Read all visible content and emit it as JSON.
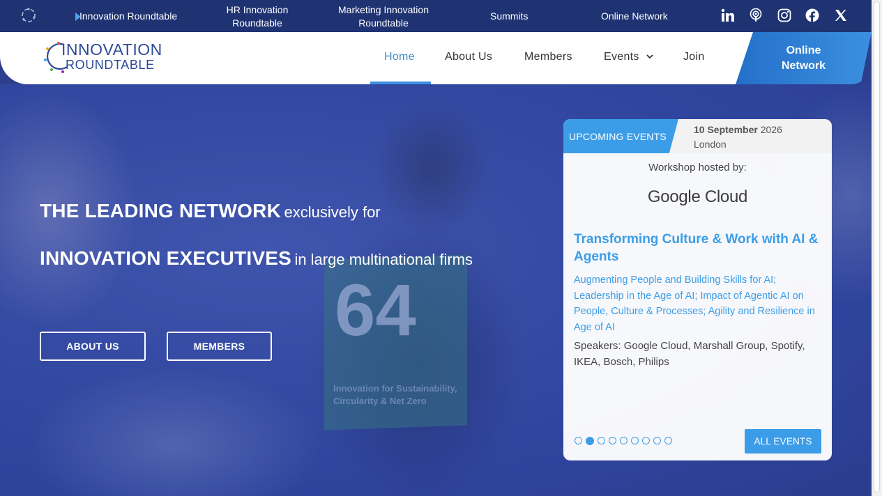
{
  "topbar": {
    "links": [
      "Innovation Roundtable",
      "HR Innovation Roundtable",
      "Marketing Innovation Roundtable",
      "Summits",
      "Online Network"
    ],
    "hr_line1": "HR Innovation",
    "hr_line2": "Roundtable",
    "mkt_line1": "Marketing Innovation",
    "mkt_line2": "Roundtable",
    "social_icons": [
      "linkedin-icon",
      "podcast-icon",
      "instagram-icon",
      "facebook-icon",
      "x-icon"
    ]
  },
  "header": {
    "logo_line1": "INNOVATION",
    "logo_line2": "ROUNDTABLE",
    "nav": [
      "Home",
      "About Us",
      "Members",
      "Events",
      "Join"
    ],
    "online_line1": "Online",
    "online_line2": "Network"
  },
  "hero": {
    "line1_bold": "THE LEADING NETWORK",
    "line1_rest": "exclusively for",
    "line2_bold": "INNOVATION EXECUTIVES",
    "line2_rest": "in large multinational firms",
    "btn_about": "ABOUT US",
    "btn_members": "MEMBERS",
    "table_number": "64",
    "table_caption": "Innovation for Sustainability, Circularity & Net Zero"
  },
  "event_card": {
    "tag": "UPCOMING EVENTS",
    "date_bold": "10 September",
    "date_year": "2026",
    "location": "London",
    "host_label": "Workshop hosted by:",
    "sponsor": "Google Cloud",
    "title": "Transforming Culture & Work with AI & Agents",
    "description": "Augmenting People and Building Skills for AI; Leadership in the Age of AI; Impact of Agentic AI on People, Culture & Processes; Agility and Resilience in Age of AI",
    "speakers": "Speakers: Google Cloud, Marshall Group, Spotify, IKEA, Bosch, Philips",
    "slide_count": 9,
    "active_slide": 2,
    "all_events": "ALL EVENTS"
  },
  "colors": {
    "accent": "#3b9de8",
    "topbar": "#1f3373",
    "hero_overlay": "#2f4495"
  }
}
